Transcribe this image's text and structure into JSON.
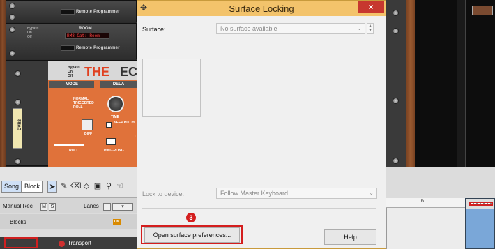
{
  "background": {
    "remote_programmer_label": "Remote Programmer",
    "bypass_labels": [
      "Bypass",
      "On",
      "Off"
    ],
    "room_label": "ROOM",
    "room_display": "RM8 Cat: Room",
    "echo_logo_the": "THE",
    "echo_logo_rest": "EC",
    "echo_sections": [
      "MODE",
      "DELA"
    ],
    "echo_mode_options": [
      "NORMAL",
      "TRIGGERED",
      "ROLL"
    ],
    "echo_controls": [
      "TIME",
      "KEEP PITCH",
      "DIFF",
      "ROLL",
      "PING-PONG",
      "L"
    ],
    "tape_label": "DVR3",
    "toolbar": {
      "song_label": "Song",
      "block_label": "Block"
    },
    "tracks": {
      "manual_rec_label": "Manual Rec",
      "m_label": "M",
      "s_label": "S",
      "lanes_label": "Lanes",
      "blocks_label": "Blocks",
      "on_badge": "ON",
      "transport_label": "Transport"
    },
    "ruler_number": "6"
  },
  "dialog": {
    "title": "Surface Locking",
    "close_glyph": "×",
    "surface_label": "Surface:",
    "surface_value": "No surface available",
    "lock_to_device_label": "Lock to device:",
    "lock_to_device_value": "Follow Master Keyboard",
    "open_prefs_button": "Open surface preferences...",
    "help_button": "Help",
    "step_badge": "3"
  },
  "colors": {
    "titlebar": "#f3c36b",
    "close": "#c7372f",
    "highlight": "#d41e1e"
  }
}
